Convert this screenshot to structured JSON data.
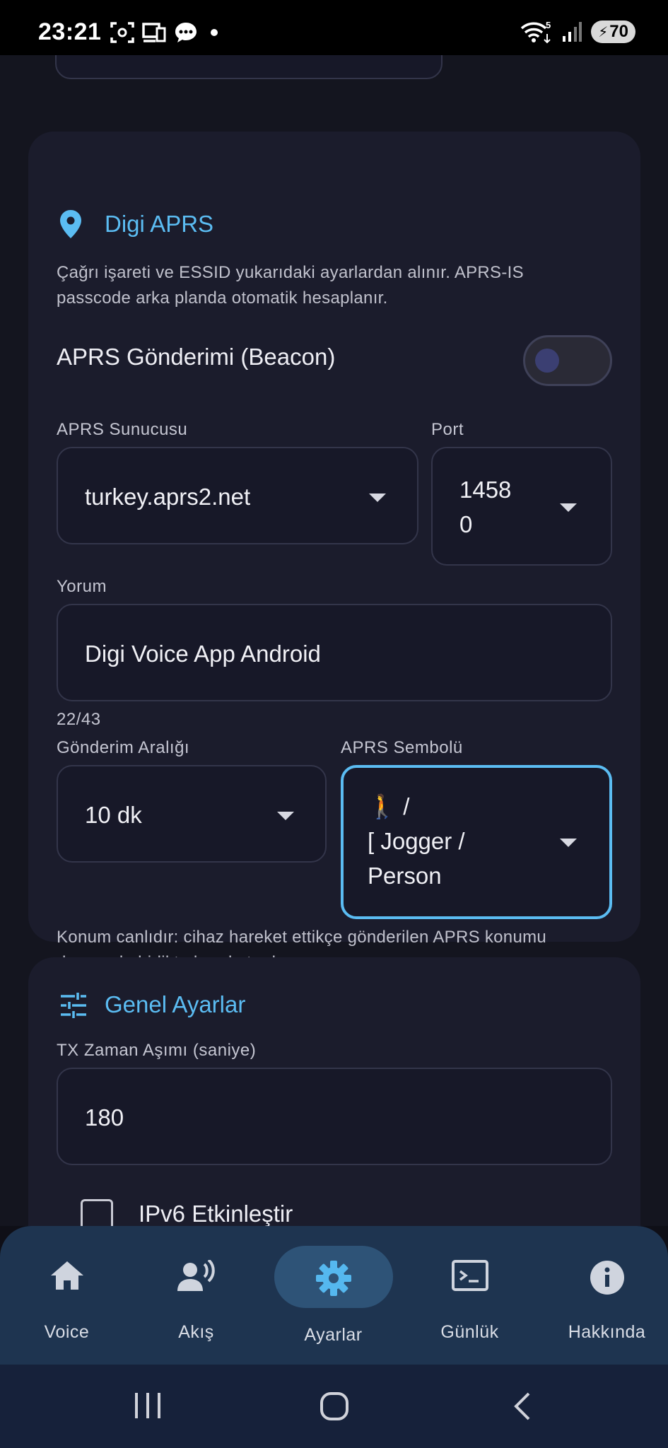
{
  "status_bar": {
    "time": "23:21",
    "wifi_label": "5",
    "battery": "70",
    "icons_left": [
      "screenshot-icon",
      "cast-icon",
      "message-icon",
      "dot-icon"
    ],
    "icons_right": [
      "wifi-icon",
      "signal-icon",
      "battery-icon"
    ]
  },
  "digi_aprs": {
    "title": "Digi APRS",
    "icon": "location-pin-icon",
    "description_line1": "Çağrı işareti ve ESSID yukarıdaki ayarlardan alınır. APRS-IS",
    "description_line2": "passcode arka planda otomatik hesaplanır.",
    "beacon_label": "APRS Gönderimi (Beacon)",
    "beacon_enabled": false,
    "server_label": "APRS Sunucusu",
    "server_value": "turkey.aprs2.net",
    "port_label": "Port",
    "port_line1": "1458",
    "port_line2": "0",
    "comment_label": "Yorum",
    "comment_value": "Digi Voice App Android",
    "comment_counter": "22/43",
    "interval_label": "Gönderim Aralığı",
    "interval_value": "10 dk",
    "symbol_label": "APRS Sembolü",
    "symbol_line1": "🚶 /",
    "symbol_line2": "[  Jogger /",
    "symbol_line3": "Person",
    "location_note_line1": "Konum canlıdır: cihaz hareket ettikçe gönderilen APRS konumu",
    "location_note_line2": "da onunla birlikte hareket eder."
  },
  "general": {
    "title": "Genel Ayarlar",
    "icon": "tune-icon",
    "tx_timeout_label": "TX Zaman Aşımı (saniye)",
    "tx_timeout_value": "180",
    "ipv6_label": "IPv6 Etkinleştir",
    "ipv6_checked": false
  },
  "bottom_nav": {
    "items": [
      {
        "label": "Voice",
        "icon": "home-icon"
      },
      {
        "label": "Akış",
        "icon": "voice-stream-icon"
      },
      {
        "label": "Ayarlar",
        "icon": "gear-icon",
        "selected": true
      },
      {
        "label": "Günlük",
        "icon": "terminal-icon"
      },
      {
        "label": "Hakkında",
        "icon": "info-icon"
      }
    ]
  },
  "system_nav": [
    "recents-button",
    "home-button",
    "back-button"
  ],
  "colors": {
    "accent": "#5bbcf2",
    "card_bg": "#1b1c2c",
    "nav_bg": "#1e3450",
    "nav_selected": "#2e5377"
  }
}
